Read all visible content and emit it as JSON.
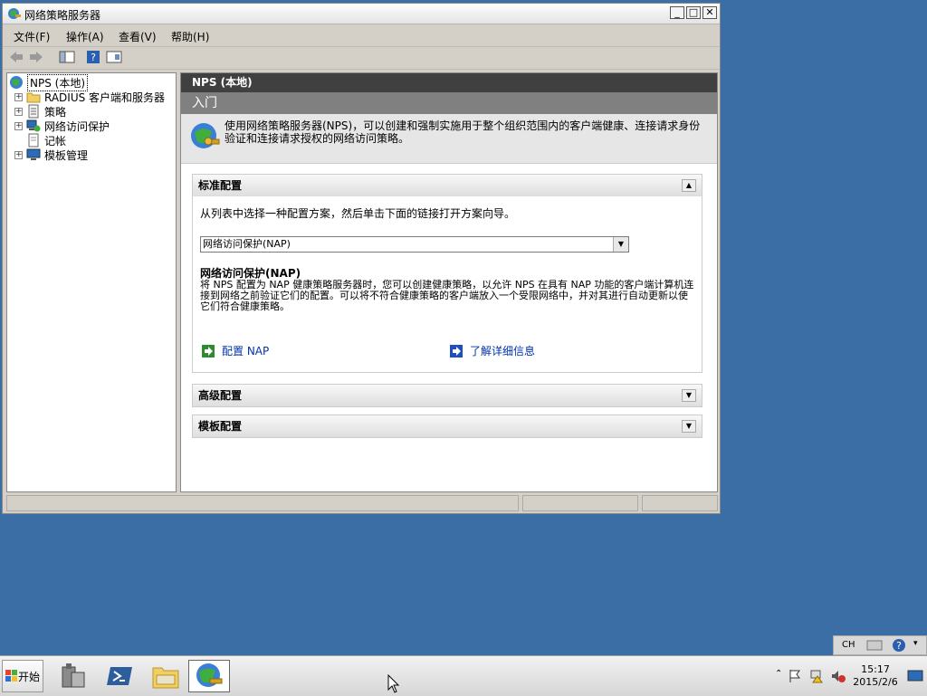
{
  "window": {
    "title": "网络策略服务器"
  },
  "menu": {
    "file": "文件(F)",
    "action": "操作(A)",
    "view": "查看(V)",
    "help": "帮助(H)"
  },
  "tree": {
    "root": "NPS (本地)",
    "items": [
      {
        "label": "RADIUS 客户端和服务器"
      },
      {
        "label": "策略"
      },
      {
        "label": "网络访问保护"
      },
      {
        "label": "记帐"
      },
      {
        "label": "模板管理"
      }
    ]
  },
  "main": {
    "header": "NPS (本地)",
    "banner": "入门",
    "intro": "使用网络策略服务器(NPS)，可以创建和强制实施用于整个组织范围内的客户端健康、连接请求身份验证和连接请求授权的网络访问策略。",
    "standard": {
      "title": "标准配置",
      "instruction": "从列表中选择一种配置方案，然后单击下面的链接打开方案向导。",
      "select_value": "网络访问保护(NAP)",
      "desc_title": "网络访问保护(NAP)",
      "desc": "将 NPS 配置为 NAP 健康策略服务器时，您可以创建健康策略，以允许 NPS 在具有 NAP 功能的客户端计算机连接到网络之前验证它们的配置。可以将不符合健康策略的客户端放入一个受限网络中，并对其进行自动更新以使它们符合健康策略。",
      "link_configure": "配置 NAP",
      "link_learn": "了解详细信息"
    },
    "advanced": {
      "title": "高级配置"
    },
    "template": {
      "title": "模板配置"
    }
  },
  "taskbar": {
    "start": "开始"
  },
  "tray": {
    "lang": "CH",
    "time": "15:17",
    "date": "2015/2/6"
  }
}
